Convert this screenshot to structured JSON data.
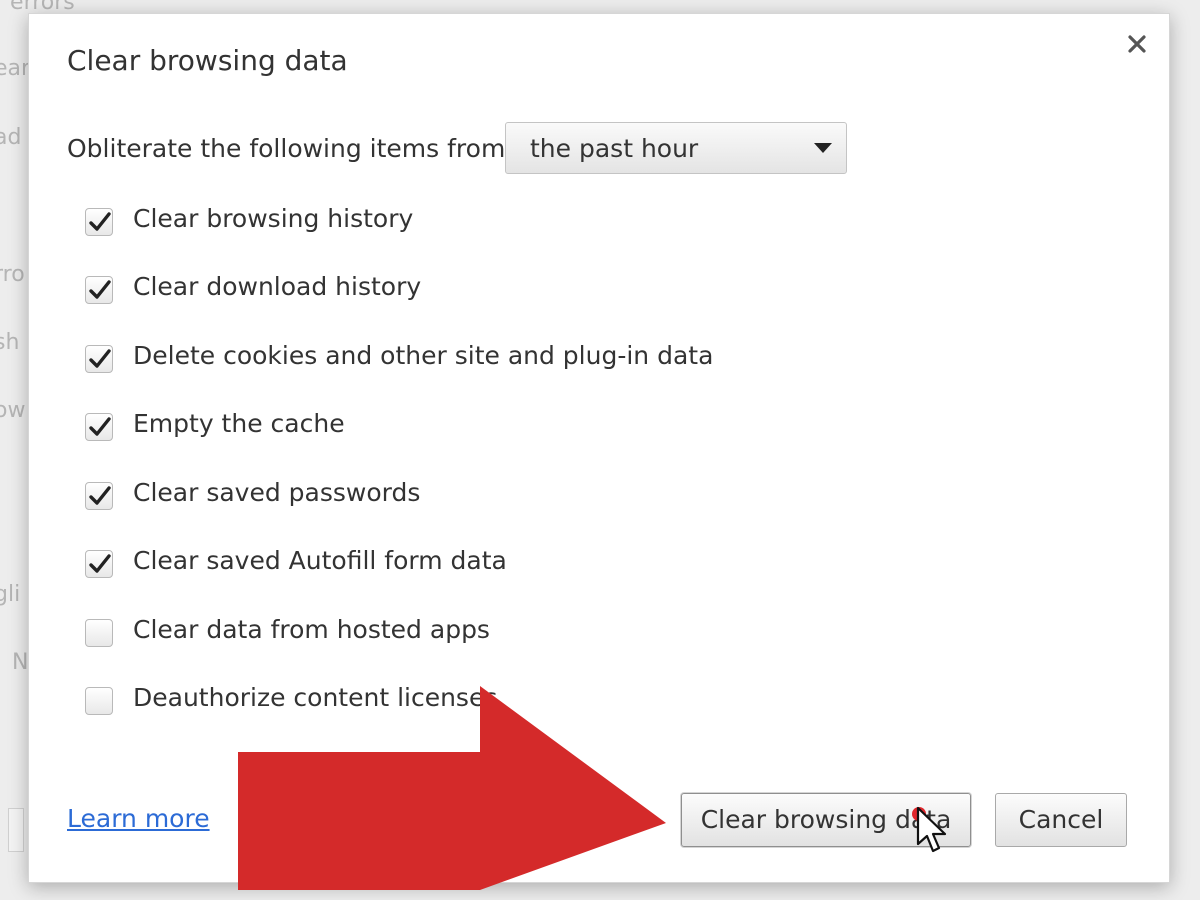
{
  "background": {
    "labels": [
      "r errors",
      "ear",
      "ad",
      "rro",
      "sh",
      "ow",
      "gli",
      "N"
    ]
  },
  "dialog": {
    "title": "Clear browsing data",
    "close_icon": "close-icon",
    "time_range": {
      "label": "Obliterate the following items from:",
      "selected": "the past hour"
    },
    "options": [
      {
        "label": "Clear browsing history",
        "checked": true
      },
      {
        "label": "Clear download history",
        "checked": true
      },
      {
        "label": "Delete cookies and other site and plug-in data",
        "checked": true
      },
      {
        "label": "Empty the cache",
        "checked": true
      },
      {
        "label": "Clear saved passwords",
        "checked": true
      },
      {
        "label": "Clear saved Autofill form data",
        "checked": true
      },
      {
        "label": "Clear data from hosted apps",
        "checked": false
      },
      {
        "label": "Deauthorize content licenses",
        "checked": false
      }
    ],
    "learn_more": "Learn more",
    "buttons": {
      "clear": "Clear browsing data",
      "cancel": "Cancel"
    }
  },
  "overlay": {
    "arrow_color": "#d42a2a",
    "click_marker_color": "#e0262b",
    "cursor_icon": "mouse-pointer-icon"
  }
}
